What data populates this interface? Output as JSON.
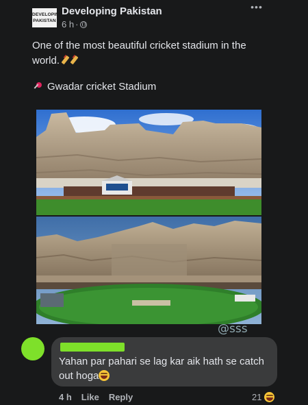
{
  "post": {
    "page_logo_line1": "DEVELOPING",
    "page_logo_line2": "PAKISTAN",
    "page_name": "Developing Pakistan",
    "time": "6 h",
    "separator": "·",
    "privacy_icon": "globe-icon",
    "more_icon": "more-options-icon",
    "more_label": "•••",
    "caption": "One of the most beautiful cricket stadium in the world.",
    "caption_emojis": [
      "cricket-bat-icon",
      "cricket-bat-icon"
    ],
    "location_icon": "pushpin-icon",
    "location": "Gwadar cricket Stadium",
    "watermark": "@sss"
  },
  "comment": {
    "avatar": "avatar",
    "text": "Yahan par pahari se lag kar aik hath se catch out hoga",
    "text_emoji": "laughing-emoji",
    "time": "4 h",
    "like_label": "Like",
    "reply_label": "Reply",
    "reaction_count": "21",
    "reaction_icon": "laughing-emoji"
  },
  "colors": {
    "background": "#18191a",
    "text": "#e4e6eb",
    "secondary_text": "#b0b3b8",
    "comment_bubble": "#3a3b3c",
    "redaction_green": "#7ee02a"
  }
}
